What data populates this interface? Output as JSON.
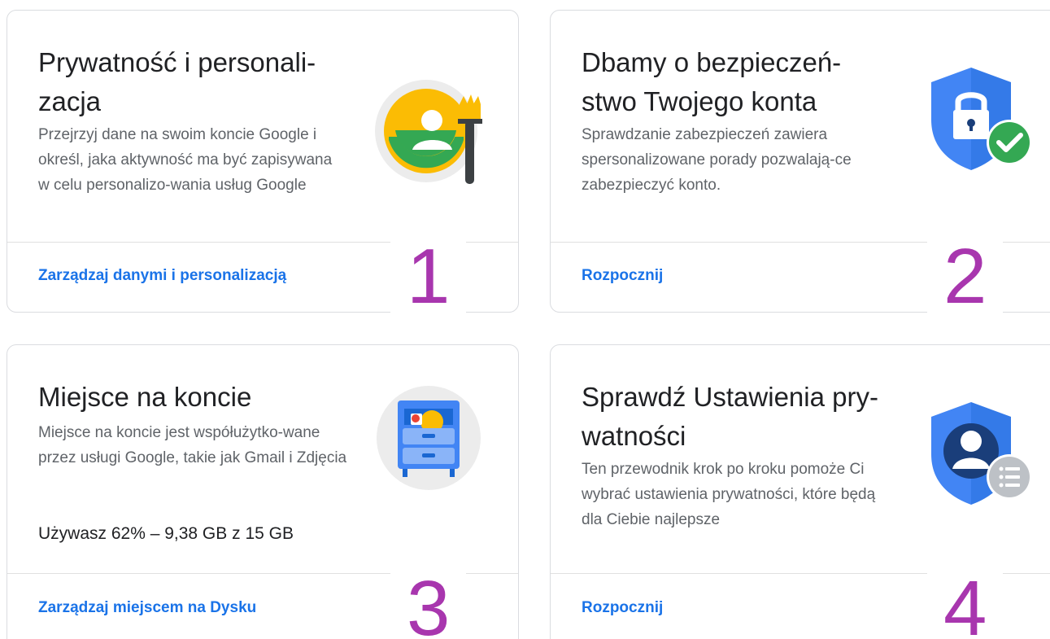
{
  "cards": [
    {
      "title": "Prywatność i personali-zacja",
      "title_line1": "Prywatność i personali-",
      "title_line2": "zacja",
      "description": "Przejrzyj dane na swoim koncie Google i określ, jaka aktywność ma być zapisywana w celu personalizo-wania usług Google",
      "link": "Zarządzaj danymi i personalizacją",
      "illustration": "personalization-icon",
      "step": "1"
    },
    {
      "title": "Dbamy o bezpieczeń-stwo Twojego konta",
      "title_line1": "Dbamy o bezpieczeń-",
      "title_line2": "stwo Twojego konta",
      "description": "Sprawdzanie zabezpieczeń zawiera spersonalizowane porady pozwalają-ce zabezpieczyć konto.",
      "link": "Rozpocznij",
      "illustration": "shield-lock-check-icon",
      "step": "2"
    },
    {
      "title": "Miejsce na koncie",
      "description": "Miejsce na koncie jest współużytko-wane przez usługi Google, takie jak Gmail i Zdjęcia",
      "usage": "Używasz 62% – 9,38 GB z 15 GB",
      "link": "Zarządzaj miejscem na Dysku",
      "illustration": "storage-cabinet-icon",
      "step": "3"
    },
    {
      "title": "Sprawdź Ustawienia pry-watności",
      "title_line1": "Sprawdź Ustawienia pry-",
      "title_line2": "watności",
      "description": "Ten przewodnik krok po kroku pomoże Ci wybrać ustawienia prywatności, które będą dla Ciebie najlepsze",
      "link": "Rozpocznij",
      "illustration": "shield-person-list-icon",
      "step": "4"
    }
  ],
  "colors": {
    "link": "#1a73e8",
    "title": "#202124",
    "description": "#5f6368",
    "step_number": "#a836ae",
    "shield_blue": "#4285f4",
    "check_green": "#34a853"
  }
}
